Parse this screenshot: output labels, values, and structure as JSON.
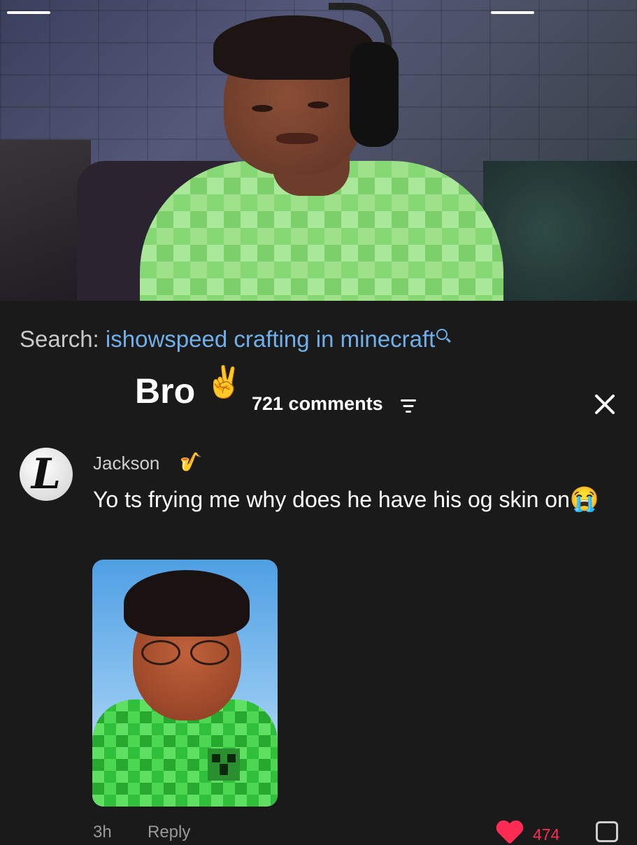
{
  "search": {
    "label": "Search:",
    "query": "ishowspeed crafting in minecraft"
  },
  "comments_panel": {
    "title": "Bro",
    "title_emoji": "✌️",
    "count_label": "721 comments"
  },
  "comment": {
    "avatar_letter": "L",
    "username": "Jackson",
    "username_emoji": "🎷",
    "text": "Yo ts frying me why does he have his og skin on",
    "text_emoji": "😭",
    "time": "3h",
    "reply_label": "Reply",
    "likes": "474"
  },
  "colors": {
    "background": "#1a1a1a",
    "search_link": "#6fb0ea",
    "like": "#fe2c55"
  }
}
